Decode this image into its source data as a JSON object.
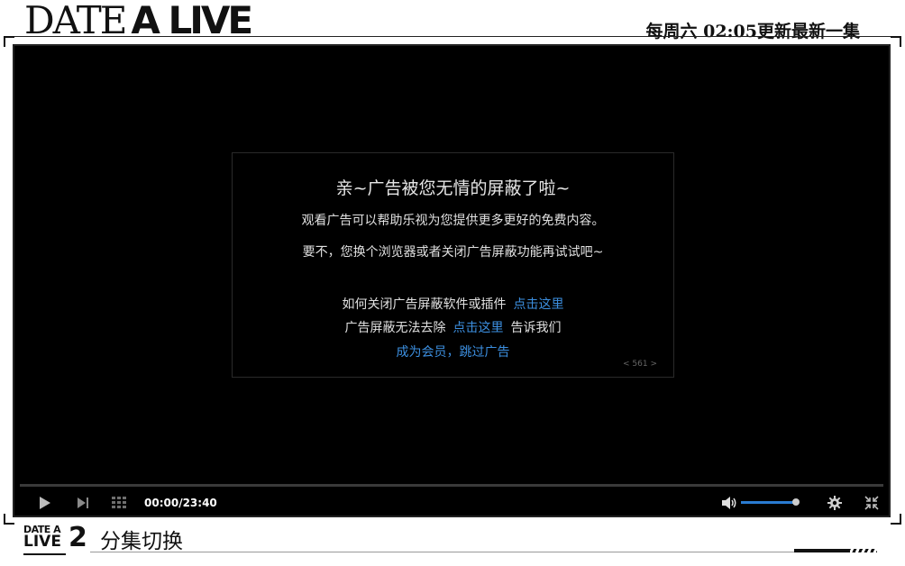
{
  "header": {
    "logo_part1": "DATE",
    "logo_part2": "A LIVE",
    "schedule": "每周六 02:05更新最新一集"
  },
  "ad_block": {
    "title": "亲~广告被您无情的屏蔽了啦~",
    "line1": "观看广告可以帮助乐视为您提供更多更好的免费内容。",
    "line2": "要不，您换个浏览器或者关闭广告屏蔽功能再试试吧~",
    "row1_text": "如何关闭广告屏蔽软件或插件",
    "row1_link": "点击这里",
    "row2_text": "广告屏蔽无法去除",
    "row2_link": "点击这里",
    "row2_suffix": "告诉我们",
    "row3_link": "成为会员，跳过广告",
    "counter": "< 561 >"
  },
  "controls": {
    "time": "00:00/23:40",
    "volume_level": 1.0,
    "icons": [
      "play-icon",
      "next-icon",
      "playlist-icon",
      "volume-icon",
      "gear-icon",
      "fullscreen-icon"
    ]
  },
  "footer": {
    "sub_logo_top": "DATE A",
    "sub_logo_bottom": "LIVE",
    "sub_logo_num": "2",
    "episode_switch": "分集切换"
  },
  "colors": {
    "link": "#3c8fe0",
    "volume": "#2a7bd2",
    "player_bg": "#000000"
  }
}
